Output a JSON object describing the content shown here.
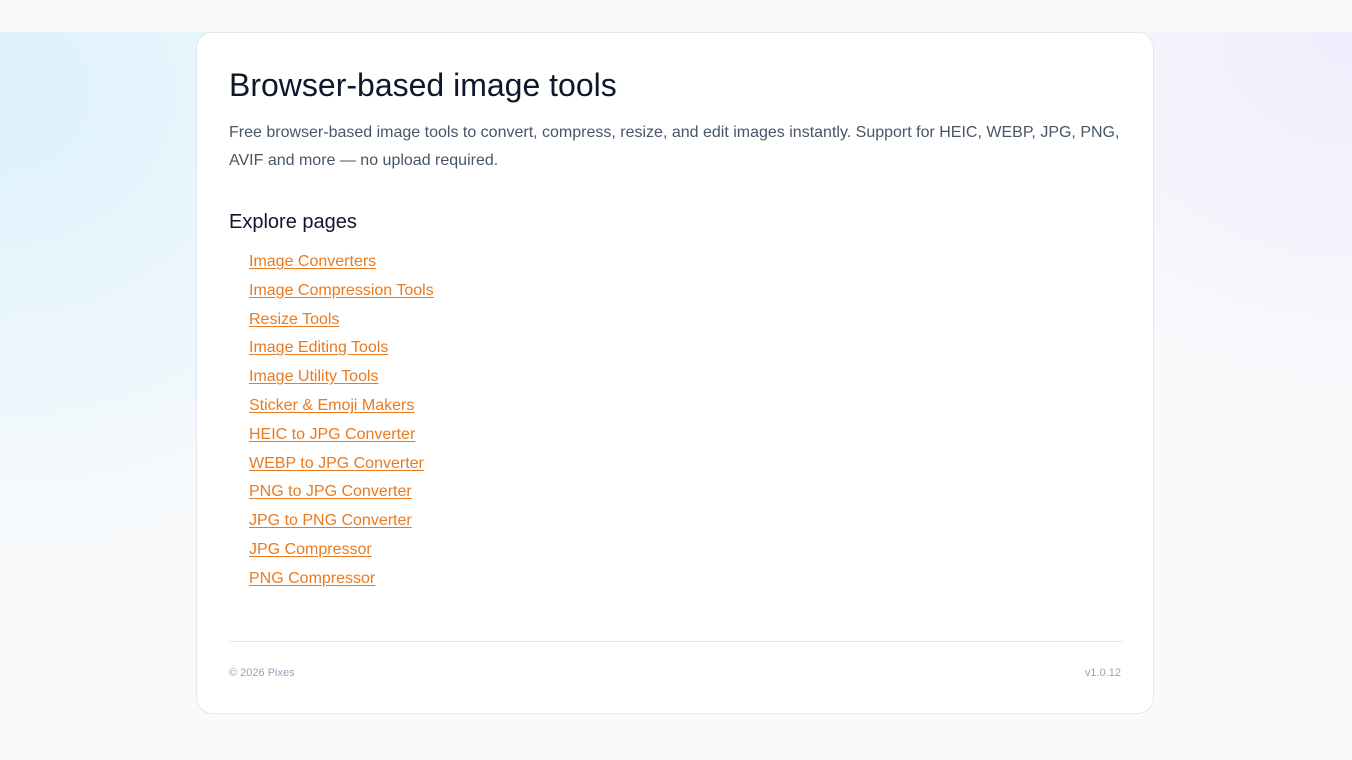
{
  "page": {
    "title": "Browser-based image tools",
    "description": "Free browser-based image tools to convert, compress, resize, and edit images instantly. Support for HEIC, WEBP, JPG, PNG, AVIF and more — no upload required."
  },
  "explore": {
    "heading": "Explore pages",
    "links": [
      {
        "label": "Image Converters"
      },
      {
        "label": "Image Compression Tools"
      },
      {
        "label": "Resize Tools"
      },
      {
        "label": "Image Editing Tools"
      },
      {
        "label": "Image Utility Tools"
      },
      {
        "label": "Sticker & Emoji Makers"
      },
      {
        "label": "HEIC to JPG Converter"
      },
      {
        "label": "WEBP to JPG Converter"
      },
      {
        "label": "PNG to JPG Converter"
      },
      {
        "label": "JPG to PNG Converter"
      },
      {
        "label": "JPG Compressor"
      },
      {
        "label": "PNG Compressor"
      }
    ]
  },
  "footer": {
    "copyright": "© 2026 Pixes",
    "version": "v1.0.12"
  },
  "colors": {
    "link": "#ea7a1f",
    "title": "#0f172a",
    "body_text": "#475569",
    "muted": "#94a3b8",
    "border": "#e2e8f0"
  }
}
